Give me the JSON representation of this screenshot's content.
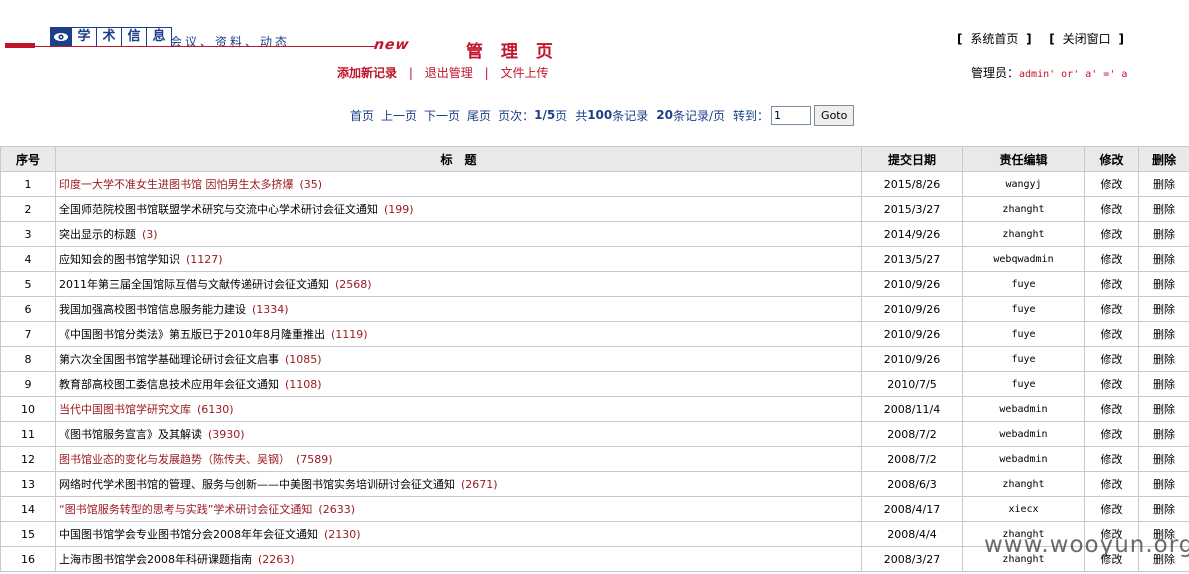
{
  "header": {
    "logo_chars": [
      "学",
      "术",
      "信",
      "息"
    ],
    "slogan": "会议、资料、动态",
    "badge": "new",
    "page_title": "管 理 页"
  },
  "actions": {
    "add": "添加新记录",
    "logout": "退出管理",
    "upload": "文件上传",
    "sep": "|"
  },
  "top_nav": {
    "home": "系统首页",
    "close": "关闭窗口",
    "bracket_open": "[",
    "bracket_close": "]"
  },
  "admin": {
    "label": "管理员：",
    "value": "admin' or' a' =' a"
  },
  "pager": {
    "first": "首页",
    "prev": "上一页",
    "next": "下一页",
    "last": "尾页",
    "page_label": "页次：",
    "page_current": "1",
    "page_total": "/5",
    "page_suffix": "页",
    "total_prefix": "共",
    "total_count": "100",
    "total_suffix": "条记录",
    "per_page_count": "20",
    "per_page_suffix": "条记录/页",
    "jump_label": "转到：",
    "jump_value": "1",
    "goto": "Goto"
  },
  "table": {
    "columns": [
      "序号",
      "标　题",
      "提交日期",
      "责任编辑",
      "修改",
      "删除"
    ],
    "rows": [
      {
        "no": "1",
        "title": "印度一大学不准女生进图书馆 因怕男生太多挤爆",
        "count": "(35)",
        "red": true,
        "date": "2015/8/26",
        "editor": "wangyj",
        "edit": "修改",
        "del": "删除"
      },
      {
        "no": "2",
        "title": "全国师范院校图书馆联盟学术研究与交流中心学术研讨会征文通知",
        "count": "(199)",
        "red": false,
        "date": "2015/3/27",
        "editor": "zhanght",
        "edit": "修改",
        "del": "删除"
      },
      {
        "no": "3",
        "title": "突出显示的标题",
        "count": "(3)",
        "red": false,
        "date": "2014/9/26",
        "editor": "zhanght",
        "edit": "修改",
        "del": "删除"
      },
      {
        "no": "4",
        "title": "应知知会的图书馆学知识",
        "count": "(1127)",
        "red": false,
        "date": "2013/5/27",
        "editor": "webqwadmin",
        "edit": "修改",
        "del": "删除"
      },
      {
        "no": "5",
        "title": "2011年第三届全国馆际互借与文献传递研讨会征文通知",
        "count": "(2568)",
        "red": false,
        "date": "2010/9/26",
        "editor": "fuye",
        "edit": "修改",
        "del": "删除"
      },
      {
        "no": "6",
        "title": "我国加强高校图书馆信息服务能力建设",
        "count": "(1334)",
        "red": false,
        "date": "2010/9/26",
        "editor": "fuye",
        "edit": "修改",
        "del": "删除"
      },
      {
        "no": "7",
        "title": "《中国图书馆分类法》第五版已于2010年8月隆重推出",
        "count": "(1119)",
        "red": false,
        "date": "2010/9/26",
        "editor": "fuye",
        "edit": "修改",
        "del": "删除"
      },
      {
        "no": "8",
        "title": "第六次全国图书馆学基础理论研讨会征文启事",
        "count": "(1085)",
        "red": false,
        "date": "2010/9/26",
        "editor": "fuye",
        "edit": "修改",
        "del": "删除"
      },
      {
        "no": "9",
        "title": "教育部高校图工委信息技术应用年会征文通知",
        "count": "(1108)",
        "red": false,
        "date": "2010/7/5",
        "editor": "fuye",
        "edit": "修改",
        "del": "删除"
      },
      {
        "no": "10",
        "title": "当代中国图书馆学研究文库",
        "count": "(6130)",
        "red": true,
        "date": "2008/11/4",
        "editor": "webadmin",
        "edit": "修改",
        "del": "删除"
      },
      {
        "no": "11",
        "title": "《图书馆服务宣言》及其解读",
        "count": "(3930)",
        "red": false,
        "date": "2008/7/2",
        "editor": "webadmin",
        "edit": "修改",
        "del": "删除"
      },
      {
        "no": "12",
        "title": "图书馆业态的变化与发展趋势（陈传夫、吴钢）",
        "count": "(7589)",
        "red": true,
        "date": "2008/7/2",
        "editor": "webadmin",
        "edit": "修改",
        "del": "删除"
      },
      {
        "no": "13",
        "title": "网络时代学术图书馆的管理、服务与创新——中美图书馆实务培训研讨会征文通知",
        "count": "(2671)",
        "red": false,
        "date": "2008/6/3",
        "editor": "zhanght",
        "edit": "修改",
        "del": "删除"
      },
      {
        "no": "14",
        "title": "“图书馆服务转型的思考与实践”学术研讨会征文通知",
        "count": "(2633)",
        "red": true,
        "date": "2008/4/17",
        "editor": "xiecx",
        "edit": "修改",
        "del": "删除"
      },
      {
        "no": "15",
        "title": "中国图书馆学会专业图书馆分会2008年年会征文通知",
        "count": "(2130)",
        "red": false,
        "date": "2008/4/4",
        "editor": "zhanght",
        "edit": "修改",
        "del": "删除"
      },
      {
        "no": "16",
        "title": "上海市图书馆学会2008年科研课题指南",
        "count": "(2263)",
        "red": false,
        "date": "2008/3/27",
        "editor": "zhanght",
        "edit": "修改",
        "del": "删除"
      }
    ]
  },
  "watermark": "www.wooyun.org",
  "colors": {
    "brand_red": "#c0152a",
    "brand_blue": "#1d3f8a",
    "title_red": "#9b1b21",
    "header_bg": "#e9e9e9",
    "border": "#c9c9c9"
  }
}
